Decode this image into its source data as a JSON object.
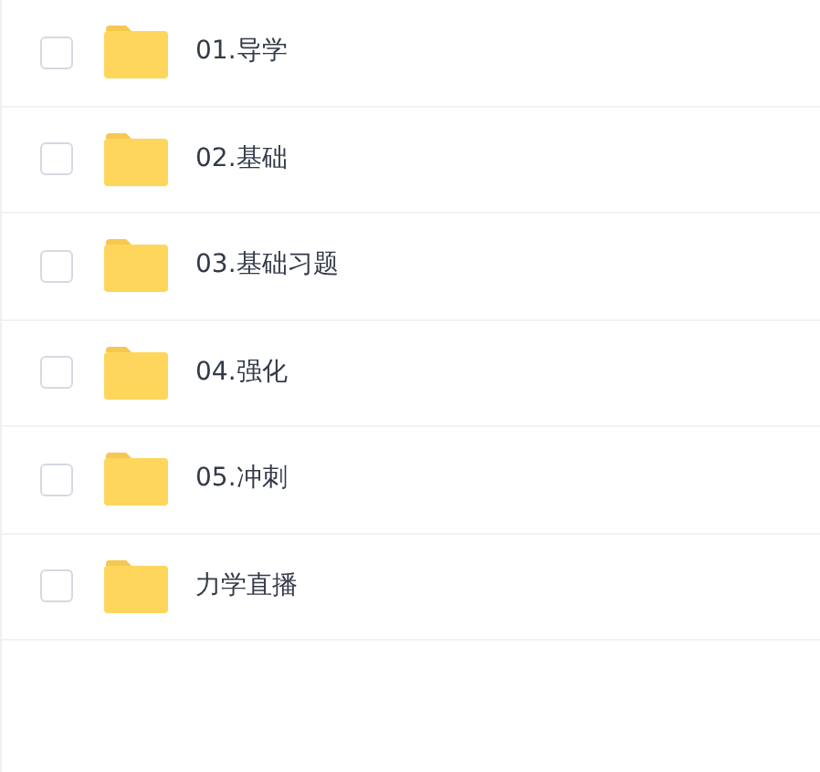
{
  "files": [
    {
      "name": "01.导学",
      "checked": false
    },
    {
      "name": "02.基础",
      "checked": false
    },
    {
      "name": "03.基础习题",
      "checked": false
    },
    {
      "name": "04.强化",
      "checked": false
    },
    {
      "name": "05.冲刺",
      "checked": false
    },
    {
      "name": "力学直播",
      "checked": false
    }
  ]
}
